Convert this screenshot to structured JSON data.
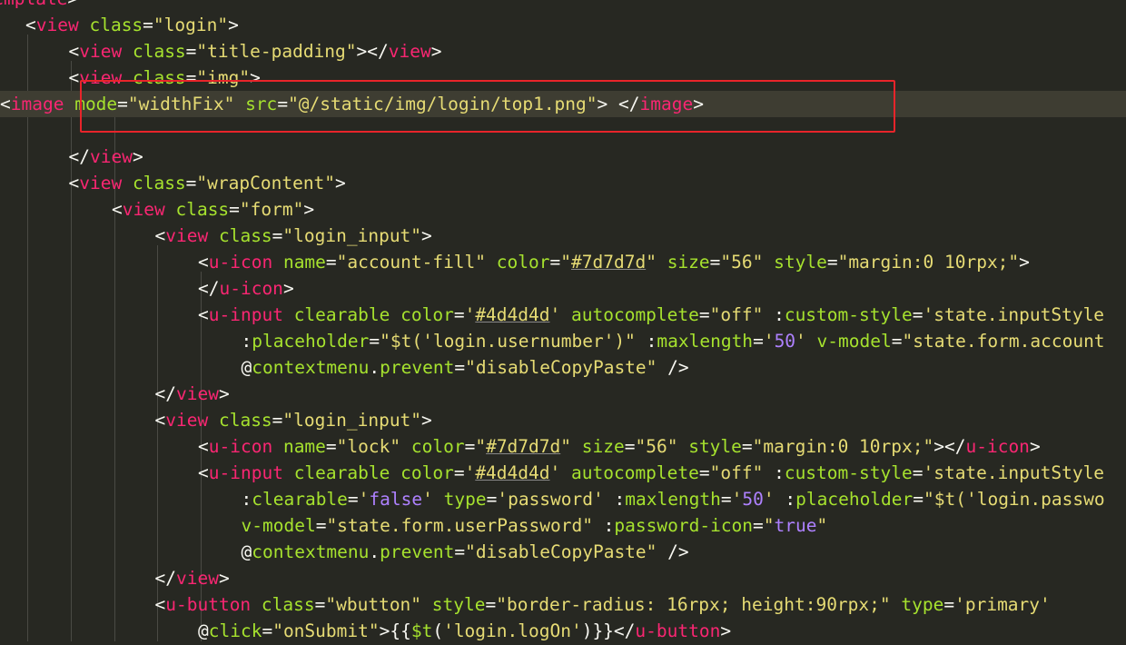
{
  "editor": {
    "theme": {
      "background": "#272822",
      "current_line": "#3e3d32",
      "tag": "#f92672",
      "attribute": "#a6e22e",
      "string": "#e6db74",
      "punct": "#f8f8f2",
      "constant": "#ae81ff",
      "highlight_box": "#e8242a"
    },
    "highlight_box_line": 3,
    "current_line_index": 4,
    "lines": [
      {
        "indent": -1,
        "tokens": [
          [
            "t",
            "template"
          ],
          [
            "p",
            ">"
          ]
        ]
      },
      {
        "indent": 0,
        "tokens": [
          [
            "p",
            "<"
          ],
          [
            "t",
            "view"
          ],
          [
            "p",
            " "
          ],
          [
            "a",
            "class"
          ],
          [
            "p",
            "="
          ],
          [
            "s",
            "\"login\""
          ],
          [
            "p",
            ">"
          ]
        ]
      },
      {
        "indent": 1,
        "tokens": [
          [
            "p",
            "<"
          ],
          [
            "t",
            "view"
          ],
          [
            "p",
            " "
          ],
          [
            "a",
            "class"
          ],
          [
            "p",
            "="
          ],
          [
            "s",
            "\"title-padding\""
          ],
          [
            "p",
            "></"
          ],
          [
            "t",
            "view"
          ],
          [
            "p",
            ">"
          ]
        ]
      },
      {
        "indent": 1,
        "tokens": [
          [
            "p",
            "<"
          ],
          [
            "t",
            "view"
          ],
          [
            "p",
            " "
          ],
          [
            "a",
            "class"
          ],
          [
            "p",
            "="
          ],
          [
            "s",
            "\"img\""
          ],
          [
            "p",
            ">"
          ]
        ]
      },
      {
        "indent": 2,
        "tokens": [
          [
            "p",
            "<"
          ],
          [
            "t",
            "image"
          ],
          [
            "p",
            " "
          ],
          [
            "a",
            "mode"
          ],
          [
            "p",
            "="
          ],
          [
            "s",
            "\"widthFix\""
          ],
          [
            "p",
            " "
          ],
          [
            "a",
            "src"
          ],
          [
            "p",
            "="
          ],
          [
            "s",
            "\"@/static/img/login/top1.png\""
          ],
          [
            "p",
            "> </"
          ],
          [
            "t",
            "image"
          ],
          [
            "p",
            ">"
          ]
        ]
      },
      {
        "indent": 2,
        "tokens": []
      },
      {
        "indent": 1,
        "tokens": [
          [
            "p",
            "</"
          ],
          [
            "t",
            "view"
          ],
          [
            "p",
            ">"
          ]
        ]
      },
      {
        "indent": 1,
        "tokens": [
          [
            "p",
            "<"
          ],
          [
            "t",
            "view"
          ],
          [
            "p",
            " "
          ],
          [
            "a",
            "class"
          ],
          [
            "p",
            "="
          ],
          [
            "s",
            "\"wrapContent\""
          ],
          [
            "p",
            ">"
          ]
        ]
      },
      {
        "indent": 2,
        "tokens": [
          [
            "p",
            "<"
          ],
          [
            "t",
            "view"
          ],
          [
            "p",
            " "
          ],
          [
            "a",
            "class"
          ],
          [
            "p",
            "="
          ],
          [
            "s",
            "\"form\""
          ],
          [
            "p",
            ">"
          ]
        ]
      },
      {
        "indent": 3,
        "tokens": [
          [
            "p",
            "<"
          ],
          [
            "t",
            "view"
          ],
          [
            "p",
            " "
          ],
          [
            "a",
            "class"
          ],
          [
            "p",
            "="
          ],
          [
            "s",
            "\"login_input\""
          ],
          [
            "p",
            ">"
          ]
        ]
      },
      {
        "indent": 4,
        "tokens": [
          [
            "p",
            "<"
          ],
          [
            "t",
            "u-icon"
          ],
          [
            "p",
            " "
          ],
          [
            "a",
            "name"
          ],
          [
            "p",
            "="
          ],
          [
            "s",
            "\"account-fill\""
          ],
          [
            "p",
            " "
          ],
          [
            "a",
            "color"
          ],
          [
            "p",
            "="
          ],
          [
            "s",
            "\""
          ],
          [
            "s ul",
            "#7d7d7d"
          ],
          [
            "s",
            "\""
          ],
          [
            "p",
            " "
          ],
          [
            "a",
            "size"
          ],
          [
            "p",
            "="
          ],
          [
            "s",
            "\"56\""
          ],
          [
            "p",
            " "
          ],
          [
            "a",
            "style"
          ],
          [
            "p",
            "="
          ],
          [
            "s",
            "\"margin:0 10rpx;\""
          ],
          [
            "p",
            ">"
          ]
        ]
      },
      {
        "indent": 4,
        "tokens": [
          [
            "p",
            "</"
          ],
          [
            "t",
            "u-icon"
          ],
          [
            "p",
            ">"
          ]
        ]
      },
      {
        "indent": 4,
        "tokens": [
          [
            "p",
            "<"
          ],
          [
            "t",
            "u-input"
          ],
          [
            "p",
            " "
          ],
          [
            "a",
            "clearable"
          ],
          [
            "p",
            " "
          ],
          [
            "a",
            "color"
          ],
          [
            "p",
            "="
          ],
          [
            "s",
            "'"
          ],
          [
            "s ul",
            "#4d4d4d"
          ],
          [
            "s",
            "'"
          ],
          [
            "p",
            " "
          ],
          [
            "a",
            "autocomplete"
          ],
          [
            "p",
            "="
          ],
          [
            "s",
            "\"off\""
          ],
          [
            "p",
            " :"
          ],
          [
            "a",
            "custom-style"
          ],
          [
            "p",
            "="
          ],
          [
            "s",
            "'state.inputStyle"
          ]
        ]
      },
      {
        "indent": 5,
        "tokens": [
          [
            "p",
            ":"
          ],
          [
            "a",
            "placeholder"
          ],
          [
            "p",
            "="
          ],
          [
            "s",
            "\"$t('login.usernumber')\""
          ],
          [
            "p",
            " :"
          ],
          [
            "a",
            "maxlength"
          ],
          [
            "p",
            "="
          ],
          [
            "s",
            "'"
          ],
          [
            "k",
            "50"
          ],
          [
            "s",
            "'"
          ],
          [
            "p",
            " "
          ],
          [
            "a",
            "v-model"
          ],
          [
            "p",
            "="
          ],
          [
            "s",
            "\"state.form.account"
          ]
        ]
      },
      {
        "indent": 5,
        "tokens": [
          [
            "p",
            "@"
          ],
          [
            "a",
            "contextmenu"
          ],
          [
            "p",
            "."
          ],
          [
            "a",
            "prevent"
          ],
          [
            "p",
            "="
          ],
          [
            "s",
            "\"disableCopyPaste\""
          ],
          [
            "p",
            " />"
          ]
        ]
      },
      {
        "indent": 3,
        "tokens": [
          [
            "p",
            "</"
          ],
          [
            "t",
            "view"
          ],
          [
            "p",
            ">"
          ]
        ]
      },
      {
        "indent": 3,
        "tokens": [
          [
            "p",
            "<"
          ],
          [
            "t",
            "view"
          ],
          [
            "p",
            " "
          ],
          [
            "a",
            "class"
          ],
          [
            "p",
            "="
          ],
          [
            "s",
            "\"login_input\""
          ],
          [
            "p",
            ">"
          ]
        ]
      },
      {
        "indent": 4,
        "tokens": [
          [
            "p",
            "<"
          ],
          [
            "t",
            "u-icon"
          ],
          [
            "p",
            " "
          ],
          [
            "a",
            "name"
          ],
          [
            "p",
            "="
          ],
          [
            "s",
            "\"lock\""
          ],
          [
            "p",
            " "
          ],
          [
            "a",
            "color"
          ],
          [
            "p",
            "="
          ],
          [
            "s",
            "\""
          ],
          [
            "s ul",
            "#7d7d7d"
          ],
          [
            "s",
            "\""
          ],
          [
            "p",
            " "
          ],
          [
            "a",
            "size"
          ],
          [
            "p",
            "="
          ],
          [
            "s",
            "\"56\""
          ],
          [
            "p",
            " "
          ],
          [
            "a",
            "style"
          ],
          [
            "p",
            "="
          ],
          [
            "s",
            "\"margin:0 10rpx;\""
          ],
          [
            "p",
            "></"
          ],
          [
            "t",
            "u-icon"
          ],
          [
            "p",
            ">"
          ]
        ]
      },
      {
        "indent": 4,
        "tokens": [
          [
            "p",
            "<"
          ],
          [
            "t",
            "u-input"
          ],
          [
            "p",
            " "
          ],
          [
            "a",
            "clearable"
          ],
          [
            "p",
            " "
          ],
          [
            "a",
            "color"
          ],
          [
            "p",
            "="
          ],
          [
            "s",
            "'"
          ],
          [
            "s ul",
            "#4d4d4d"
          ],
          [
            "s",
            "'"
          ],
          [
            "p",
            " "
          ],
          [
            "a",
            "autocomplete"
          ],
          [
            "p",
            "="
          ],
          [
            "s",
            "\"off\""
          ],
          [
            "p",
            " :"
          ],
          [
            "a",
            "custom-style"
          ],
          [
            "p",
            "="
          ],
          [
            "s",
            "'state.inputStyle"
          ]
        ]
      },
      {
        "indent": 5,
        "tokens": [
          [
            "p",
            ":"
          ],
          [
            "a",
            "clearable"
          ],
          [
            "p",
            "="
          ],
          [
            "s",
            "'"
          ],
          [
            "k",
            "false"
          ],
          [
            "s",
            "'"
          ],
          [
            "p",
            " "
          ],
          [
            "a",
            "type"
          ],
          [
            "p",
            "="
          ],
          [
            "s",
            "'password'"
          ],
          [
            "p",
            " :"
          ],
          [
            "a",
            "maxlength"
          ],
          [
            "p",
            "="
          ],
          [
            "s",
            "'"
          ],
          [
            "k",
            "50"
          ],
          [
            "s",
            "'"
          ],
          [
            "p",
            " :"
          ],
          [
            "a",
            "placeholder"
          ],
          [
            "p",
            "="
          ],
          [
            "s",
            "\"$t('login.passwo"
          ]
        ]
      },
      {
        "indent": 5,
        "tokens": [
          [
            "a",
            "v-model"
          ],
          [
            "p",
            "="
          ],
          [
            "s",
            "\"state.form.userPassword\""
          ],
          [
            "p",
            " :"
          ],
          [
            "a",
            "password-icon"
          ],
          [
            "p",
            "="
          ],
          [
            "s",
            "\""
          ],
          [
            "k",
            "true"
          ],
          [
            "s",
            "\""
          ]
        ]
      },
      {
        "indent": 5,
        "tokens": [
          [
            "p",
            "@"
          ],
          [
            "a",
            "contextmenu"
          ],
          [
            "p",
            "."
          ],
          [
            "a",
            "prevent"
          ],
          [
            "p",
            "="
          ],
          [
            "s",
            "\"disableCopyPaste\""
          ],
          [
            "p",
            " />"
          ]
        ]
      },
      {
        "indent": 3,
        "tokens": [
          [
            "p",
            "</"
          ],
          [
            "t",
            "view"
          ],
          [
            "p",
            ">"
          ]
        ]
      },
      {
        "indent": 3,
        "tokens": [
          [
            "p",
            "<"
          ],
          [
            "t",
            "u-button"
          ],
          [
            "p",
            " "
          ],
          [
            "a",
            "class"
          ],
          [
            "p",
            "="
          ],
          [
            "s",
            "\"wbutton\""
          ],
          [
            "p",
            " "
          ],
          [
            "a",
            "style"
          ],
          [
            "p",
            "="
          ],
          [
            "s",
            "\"border-radius: 16rpx; height:90rpx;\""
          ],
          [
            "p",
            " "
          ],
          [
            "a",
            "type"
          ],
          [
            "p",
            "="
          ],
          [
            "s",
            "'primary'"
          ]
        ]
      },
      {
        "indent": 4,
        "tokens": [
          [
            "p",
            "@"
          ],
          [
            "a",
            "click"
          ],
          [
            "p",
            "="
          ],
          [
            "s",
            "\"onSubmit\""
          ],
          [
            "p",
            ">{{"
          ],
          [
            "a",
            "$t"
          ],
          [
            "p",
            "("
          ],
          [
            "s",
            "'login.logOn'"
          ],
          [
            "p",
            ")}}</"
          ],
          [
            "t",
            "u-button"
          ],
          [
            "p",
            ">"
          ]
        ]
      }
    ]
  }
}
